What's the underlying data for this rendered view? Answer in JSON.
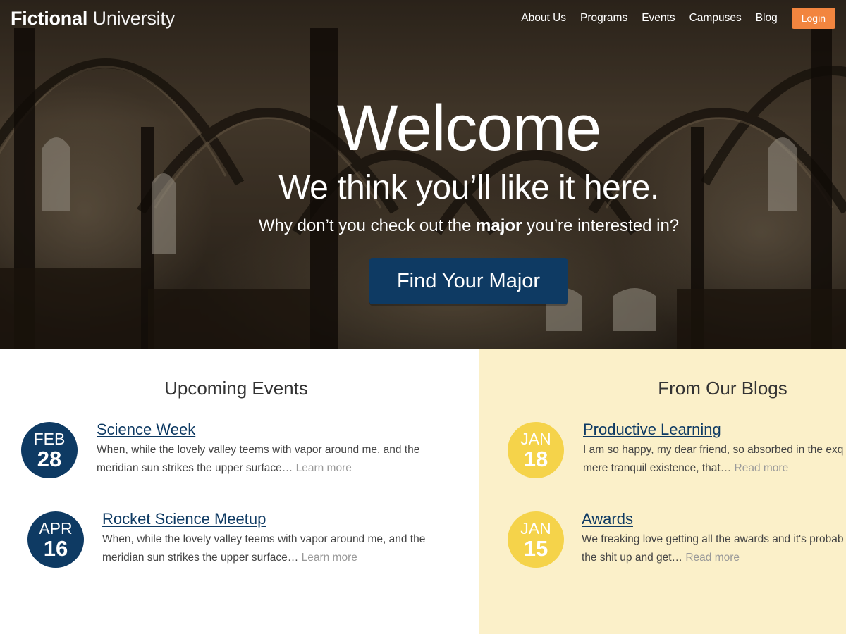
{
  "header": {
    "logo_strong": "Fictional",
    "logo_light": "University",
    "nav": [
      "About Us",
      "Programs",
      "Events",
      "Campuses",
      "Blog"
    ],
    "login_label": "Login"
  },
  "hero": {
    "title": "Welcome",
    "subtitle": "We think you’ll like it here.",
    "desc_before": "Why don’t you check out the ",
    "desc_bold": "major",
    "desc_after": " you’re interested in?",
    "cta_label": "Find Your Major"
  },
  "events": {
    "title": "Upcoming Events",
    "items": [
      {
        "month": "FEB",
        "day": "28",
        "title": "Science Week",
        "line1": "When, while the lovely valley teems with vapor around me, and the",
        "line2": "meridian sun strikes the upper surface…",
        "more": "Learn more"
      },
      {
        "month": "APR",
        "day": "16",
        "title": "Rocket Science Meetup",
        "line1": "When, while the lovely valley teems with vapor around me, and the",
        "line2": "meridian sun strikes the upper surface…",
        "more": "Learn more"
      }
    ]
  },
  "blogs": {
    "title": "From Our Blogs",
    "items": [
      {
        "month": "JAN",
        "day": "18",
        "title": "Productive Learning",
        "line1": "I am so happy, my dear friend, so absorbed in the exq",
        "line2": "mere tranquil existence, that…",
        "more": "Read more"
      },
      {
        "month": "JAN",
        "day": "15",
        "title": "Awards",
        "line1": "We freaking love getting all the awards and it's probab",
        "line2": "the shit up and get…",
        "more": "Read more"
      }
    ]
  },
  "colors": {
    "navy": "#0e3a63",
    "orange": "#f2853f",
    "gold": "#f5d34a",
    "cream": "#fbf0c9"
  }
}
